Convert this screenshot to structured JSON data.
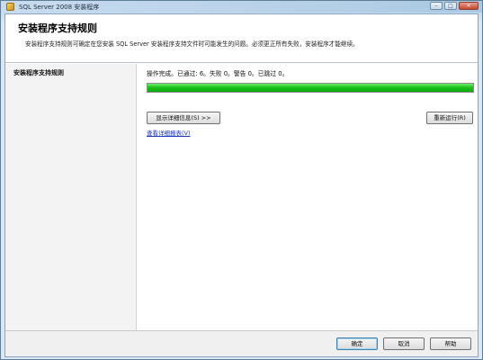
{
  "window": {
    "title": "SQL Server 2008 安装程序"
  },
  "header": {
    "title": "安装程序支持规则",
    "description": "安装程序支持规则可确定在您安装 SQL Server 安装程序支持文件时可能发生的问题。必须更正所有失败，安装程序才能继续。"
  },
  "sidebar": {
    "items": [
      {
        "label": "安装程序支持规则"
      }
    ]
  },
  "main": {
    "status_text": "操作完成。已通过: 6。失败 0。警告 0。已跳过 0。",
    "progress_fraction": 1.0,
    "progress_color": "#1cc21c",
    "show_details_label": "显示详细信息(S) >>",
    "rerun_label": "重新运行(R)",
    "report_link": "查看详细报表(V)"
  },
  "footer": {
    "ok_label": "确定",
    "cancel_label": "取消",
    "help_label": "帮助"
  },
  "icons": {
    "app": "sql-server-setup-icon"
  }
}
